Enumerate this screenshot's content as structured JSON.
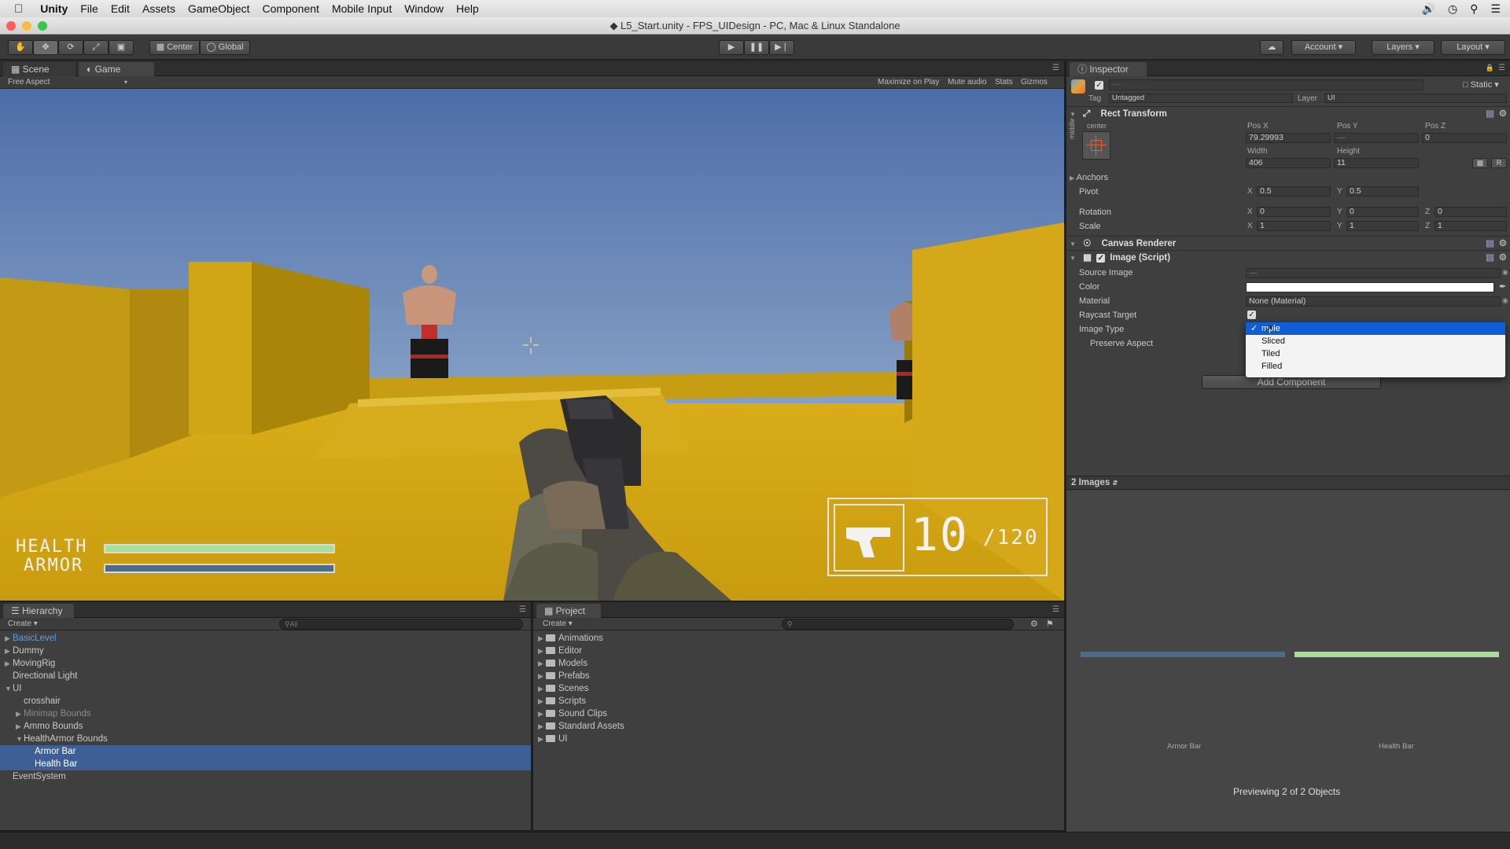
{
  "menubar": {
    "app": "Unity",
    "items": [
      "File",
      "Edit",
      "Assets",
      "GameObject",
      "Component",
      "Mobile Input",
      "Window",
      "Help"
    ]
  },
  "window": {
    "title": "L5_Start.unity - FPS_UIDesign - PC, Mac & Linux Standalone"
  },
  "toolbar": {
    "pivot": "Center",
    "space": "Global",
    "account": "Account",
    "layers": "Layers",
    "layout": "Layout"
  },
  "game_view": {
    "tabs": [
      "Scene",
      "Game"
    ],
    "aspect": "Free Aspect",
    "options": [
      "Maximize on Play",
      "Mute audio",
      "Stats",
      "Gizmos"
    ],
    "hud": {
      "health_label": "HEALTH",
      "armor_label": "ARMOR",
      "ammo_current": "10",
      "ammo_total": "/120",
      "health_fill": 1.0,
      "armor_fill": 1.0
    }
  },
  "hierarchy": {
    "title": "Hierarchy",
    "create": "Create",
    "search_placeholder": "All",
    "items": [
      {
        "label": "BasicLevel",
        "depth": 0,
        "arrow": "right",
        "highlight": "blue"
      },
      {
        "label": "Dummy",
        "depth": 0,
        "arrow": "right"
      },
      {
        "label": "MovingRig",
        "depth": 0,
        "arrow": "right"
      },
      {
        "label": "Directional Light",
        "depth": 0,
        "arrow": ""
      },
      {
        "label": "UI",
        "depth": 0,
        "arrow": "down"
      },
      {
        "label": "crosshair",
        "depth": 1,
        "arrow": ""
      },
      {
        "label": "Minimap Bounds",
        "depth": 1,
        "arrow": "right",
        "dim": true
      },
      {
        "label": "Ammo Bounds",
        "depth": 1,
        "arrow": "right"
      },
      {
        "label": "HealthArmor Bounds",
        "depth": 1,
        "arrow": "down"
      },
      {
        "label": "Armor Bar",
        "depth": 2,
        "arrow": "",
        "selected": true
      },
      {
        "label": "Health Bar",
        "depth": 2,
        "arrow": "",
        "selected": true
      },
      {
        "label": "EventSystem",
        "depth": 0,
        "arrow": ""
      }
    ]
  },
  "project": {
    "title": "Project",
    "create": "Create",
    "folders": [
      "Animations",
      "Editor",
      "Models",
      "Prefabs",
      "Scenes",
      "Scripts",
      "Sound Clips",
      "Standard Assets",
      "UI"
    ]
  },
  "inspector": {
    "title": "Inspector",
    "static": "Static",
    "tag_label": "Tag",
    "tag_value": "Untagged",
    "layer_label": "Layer",
    "layer_value": "UI",
    "rect_transform": {
      "title": "Rect Transform",
      "anchor_h": "center",
      "anchor_v": "middle",
      "pos_x_label": "Pos X",
      "pos_x": "79.29993",
      "pos_y_label": "Pos Y",
      "pos_y": "—",
      "pos_z_label": "Pos Z",
      "pos_z": "0",
      "width_label": "Width",
      "width": "406",
      "height_label": "Height",
      "height": "11",
      "anchors": "Anchors",
      "pivot": "Pivot",
      "pivot_x": "0.5",
      "pivot_y": "0.5",
      "rotation": "Rotation",
      "rot_x": "0",
      "rot_y": "0",
      "rot_z": "0",
      "scale": "Scale",
      "scale_x": "1",
      "scale_y": "1",
      "scale_z": "1",
      "raw_btn": "R"
    },
    "canvas_renderer": "Canvas Renderer",
    "image_script": {
      "title": "Image (Script)",
      "source_image": "Source Image",
      "source_value": "—",
      "color": "Color",
      "material": "Material",
      "material_value": "None (Material)",
      "raycast": "Raycast Target",
      "image_type": "Image Type",
      "preserve_aspect": "Preserve Aspect"
    },
    "dropdown": {
      "options": [
        "Simple",
        "Sliced",
        "Tiled",
        "Filled"
      ],
      "selected_display": "mple",
      "selected_index": 0
    },
    "add_component": "Add Component",
    "preview": {
      "header": "2 Images",
      "label_left": "Armor Bar",
      "label_right": "Health Bar",
      "footer": "Previewing 2 of 2 Objects",
      "color_left": "#4d6b8a",
      "color_right": "#a8e09a"
    }
  },
  "colors": {
    "selection": "#3e5f96",
    "dropdown_highlight": "#0f5ed8",
    "health_bar": "#a8e09a",
    "armor_bar": "#4d6b8a"
  }
}
